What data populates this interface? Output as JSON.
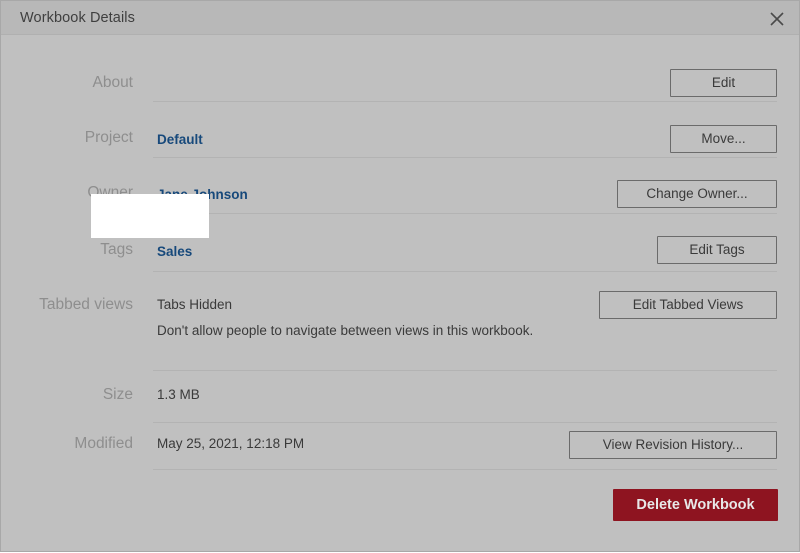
{
  "window": {
    "title": "Workbook Details",
    "close_icon": "close-icon",
    "background_color": "#c0c0c0",
    "titlebar_color": "#b8b8b8"
  },
  "colors": {
    "link": "#17497b",
    "label": "#8e8e8e",
    "value": "#3a3a3a",
    "divider": "#b3b3b3",
    "danger": "#8e1420",
    "highlight": "#ffffff"
  },
  "rows": [
    {
      "label": "About",
      "value": "",
      "button": "Edit"
    },
    {
      "label": "Project",
      "value": "Default",
      "button": "Move..."
    },
    {
      "label": "Owner",
      "value": "Jane Johnson",
      "button": "Change Owner..."
    },
    {
      "label": "Tags",
      "value": "Sales",
      "button": "Edit Tags"
    },
    {
      "label": "Tabbed views",
      "value": "Tabs Hidden",
      "description": "Don't allow people to navigate between views in this workbook.",
      "button": "Edit Tabbed Views"
    },
    {
      "label": "Size",
      "value": "1.3 MB",
      "button": ""
    },
    {
      "label": "Modified",
      "value": "May 25, 2021, 12:18 PM",
      "button": "View Revision History..."
    }
  ],
  "footer": {
    "delete_label": "Delete Workbook"
  }
}
